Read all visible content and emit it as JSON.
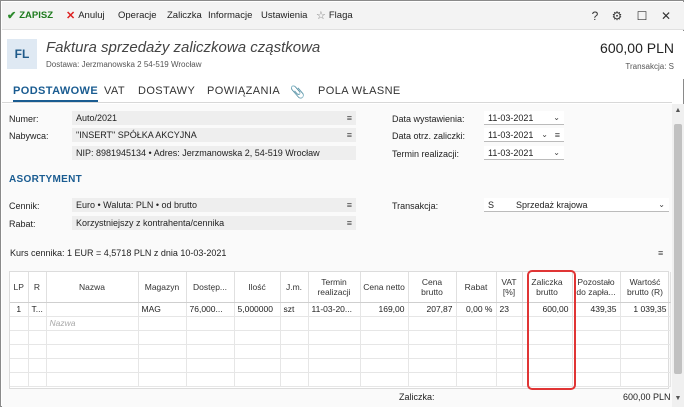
{
  "toolbar": {
    "save": "ZAPISZ",
    "cancel": "Anuluj",
    "operations": "Operacje",
    "advance": "Zaliczka",
    "information": "Informacje",
    "settings": "Ustawienia",
    "flag": "Flaga",
    "help": "?"
  },
  "header": {
    "badge": "FL",
    "title": "Faktura sprzedaży zaliczkowa cząstkowa",
    "delivery": "Dostawa: Jerzmanowska 2 54-519 Wrocław",
    "amount": "600,00 PLN",
    "transaction": "Transakcja:  S"
  },
  "tabs": [
    "PODSTAWOWE",
    "VAT",
    "DOSTAWY",
    "POWIĄZANIA",
    "POLA WŁASNE"
  ],
  "form": {
    "number_label": "Numer:",
    "number_value": "Auto/2021",
    "buyer_label": "Nabywca:",
    "buyer_value": "\"INSERT\" SPÓŁKA AKCYJNA",
    "buyer_details": "NIP:  8981945134  •  Adres:  Jerzmanowska 2, 54-519 Wrocław",
    "issue_date_label": "Data wystawienia:",
    "issue_date_value": "11-03-2021",
    "advance_date_label": "Data otrz. zaliczki:",
    "advance_date_value": "11-03-2021",
    "due_label": "Termin realizacji:",
    "due_value": "11-03-2021"
  },
  "assortment": {
    "title": "ASORTYMENT",
    "pricelist_label": "Cennik:",
    "pricelist_value": "Euro • Waluta: PLN • od brutto",
    "discount_label": "Rabat:",
    "discount_value": "Korzystniejszy z kontrahenta/cennika",
    "transaction_label": "Transakcja:",
    "transaction_code": "S",
    "transaction_value": "Sprzedaż krajowa",
    "rate": "Kurs cennika: 1 EUR = 4,5718 PLN z dnia 10-03-2021"
  },
  "grid": {
    "columns": [
      "LP",
      "R",
      "Nazwa",
      "Magazyn",
      "Dostęp...",
      "Ilość",
      "J.m.",
      "Termin realizacji",
      "Cena netto",
      "Cena brutto",
      "Rabat",
      "VAT [%]",
      "Zaliczka brutto",
      "Pozostało do zapła...",
      "Wartość brutto (R)"
    ],
    "rows": [
      [
        "1",
        "T...",
        "",
        "MAG",
        "76,000...",
        "5,000000",
        "szt",
        "11-03-20...",
        "169,00",
        "207,87",
        "0,00 %",
        "23",
        "600,00",
        "439,35",
        "1 039,35"
      ]
    ],
    "placeholder": "Nazwa"
  },
  "footer": {
    "label": "Zaliczka:",
    "value": "600,00 PLN"
  }
}
